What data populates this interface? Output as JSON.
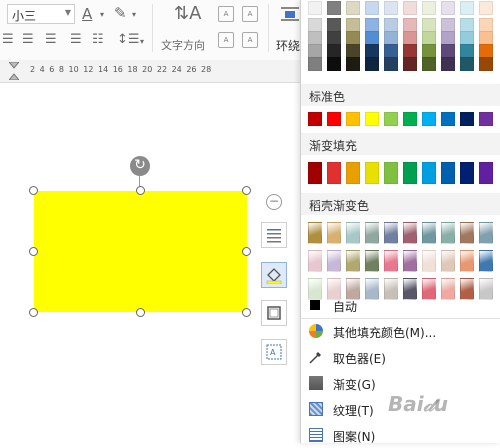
{
  "toolbar": {
    "font_size_value": "小三",
    "text_direction_label": "文字方向",
    "wrap_label": "环绕"
  },
  "ruler": {
    "numbers": "2   4   6   8   10   12   14   16   18   20   22   24   26   28"
  },
  "panel": {
    "standard_colors_title": "标准色",
    "gradient_fill_title": "渐变填充",
    "shell_gradient_title": "稻壳渐变色",
    "auto_label": "自动",
    "more_colors_label": "其他填充颜色(M)...",
    "eyedropper_label": "取色器(E)",
    "gradient_label": "渐变(G)",
    "texture_label": "纹理(T)",
    "pattern_label": "图案(N)",
    "standard_colors": [
      "#c00000",
      "#ff0000",
      "#ffc000",
      "#ffff00",
      "#92d050",
      "#00b050",
      "#00b0f0",
      "#0070c0",
      "#002060",
      "#7030a0"
    ],
    "gradient_colors": [
      "#a00000",
      "#e03030",
      "#e8a000",
      "#e8e000",
      "#80c040",
      "#00a050",
      "#00a0e0",
      "#0060b0",
      "#002070",
      "#6020a0"
    ],
    "shell_gradient_row1": [
      "#b09040",
      "#d8b070",
      "#a8c8c8",
      "#90a8a0",
      "#7080a0",
      "#a06070",
      "#7098a0",
      "#88b0a8",
      "#a07860",
      "#80a0b0"
    ],
    "shell_gradient_row2": [
      "#e8c8d0",
      "#c8b8d8",
      "#b0a870",
      "#708060",
      "#e87890",
      "#a070a0",
      "#f0e0d8",
      "#e0c8b8",
      "#e89870",
      "#4078b0"
    ],
    "shell_gradient_row3": [
      "#d8e8d0",
      "#e8d0d0",
      "#c0a8a0",
      "#a8b8c8",
      "#c8c0b8",
      "#585868",
      "#e06878",
      "#f0a8a0",
      "#b06048",
      "#c8c8c8"
    ],
    "theme_colors_top": [
      "#f2f2f2",
      "#808080",
      "#ddd9c3",
      "#c6d9f1",
      "#dbe5f1",
      "#f2dcdb",
      "#ebf1de",
      "#e5e0ec",
      "#dbeef4",
      "#fde9d9"
    ],
    "theme_colors_rows": [
      [
        "#d9d9d9",
        "#595959",
        "#c4bd97",
        "#8db3e2",
        "#b8cce4",
        "#e6b9b8",
        "#d7e4bd",
        "#ccc1da",
        "#b7dde8",
        "#fbd5b5"
      ],
      [
        "#bfbfbf",
        "#404040",
        "#948a54",
        "#548dd4",
        "#95b3d7",
        "#d99694",
        "#c3d69b",
        "#b2a2c7",
        "#93cddd",
        "#fac08f"
      ],
      [
        "#a6a6a6",
        "#262626",
        "#4a452a",
        "#17375e",
        "#366092",
        "#953735",
        "#76923c",
        "#5f497a",
        "#31859c",
        "#e36c09"
      ],
      [
        "#7f7f7f",
        "#0d0d0d",
        "#1e1c11",
        "#0f243e",
        "#244061",
        "#632523",
        "#4f6228",
        "#3f3151",
        "#205867",
        "#974806"
      ]
    ]
  }
}
